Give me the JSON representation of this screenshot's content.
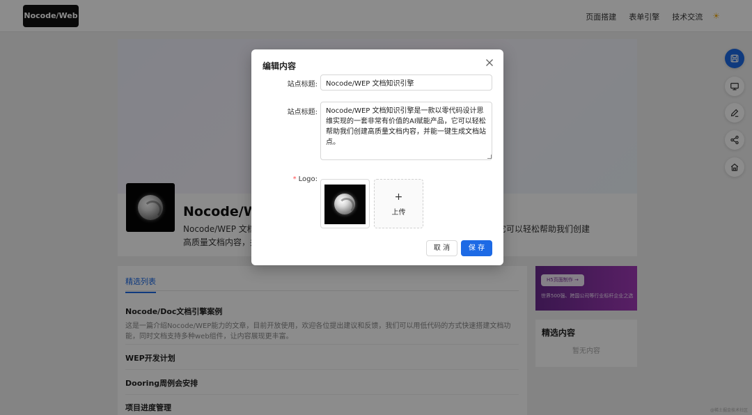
{
  "header": {
    "brand": "Nocode/Web",
    "nav": [
      "页面搭建",
      "表单引擎",
      "技术交流"
    ],
    "theme_icon": "sun-icon"
  },
  "hero": {
    "title": "Nocode/WEP 文档知识引擎",
    "desc_line1": "Nocode/WEP 文档知识引擎是一款以零代码设计思维实现的一套非常有价值的AI赋能产品，它可以轻松帮助我们创建",
    "desc_line1_tail": "它可以轻松帮助我们创建",
    "desc_line2": "高质量文档内容，并能一键生成文档站点。"
  },
  "list": {
    "tab": "精选列表",
    "articles": [
      {
        "title": "Nocode/Doc文档引擎案例",
        "summary": "这是一篇介绍Nocode/WEP能力的文章，目前开放使用，欢迎各位提出建议和反馈，我们可以用低代码的方式快速搭建文档功能，同时文档支持多种web组件，让内容展现更丰富。"
      },
      {
        "title": "WEP开发计划"
      },
      {
        "title": "Dooring周例会安排"
      },
      {
        "title": "项目进度管理"
      }
    ]
  },
  "ad": {
    "pill": "H5页面制作 →",
    "text": "世界500强、跨国公司等行业标杆企业之选"
  },
  "featured": {
    "title": "精选内容",
    "empty": "暂无内容"
  },
  "side_actions": [
    "save-icon",
    "monitor-icon",
    "edit-icon",
    "share-icon",
    "home-icon"
  ],
  "watermark": "@稀土掘金技术社区",
  "modal": {
    "title": "编辑内容",
    "site_title_label": "站点标题:",
    "site_title_value": "Nocode/WEP 文档知识引擎",
    "site_desc_label": "站点标题:",
    "site_desc_value": "Nocode/WEP 文档知识引擎是一款以零代码设计思维实现的一套非常有价值的AI赋能产品，它可以轻松帮助我们创建高质量文档内容，并能一键生成文档站点。",
    "logo_label": "Logo:",
    "logo_required": "*",
    "upload_plus": "+",
    "upload_text": "上传",
    "cancel": "取 消",
    "save": "保 存"
  },
  "colors": {
    "primary": "#1d6ae5",
    "required": "#ff4d4f",
    "ad_gradient_start": "#6a2a8e",
    "ad_gradient_end": "#a13ab8"
  }
}
